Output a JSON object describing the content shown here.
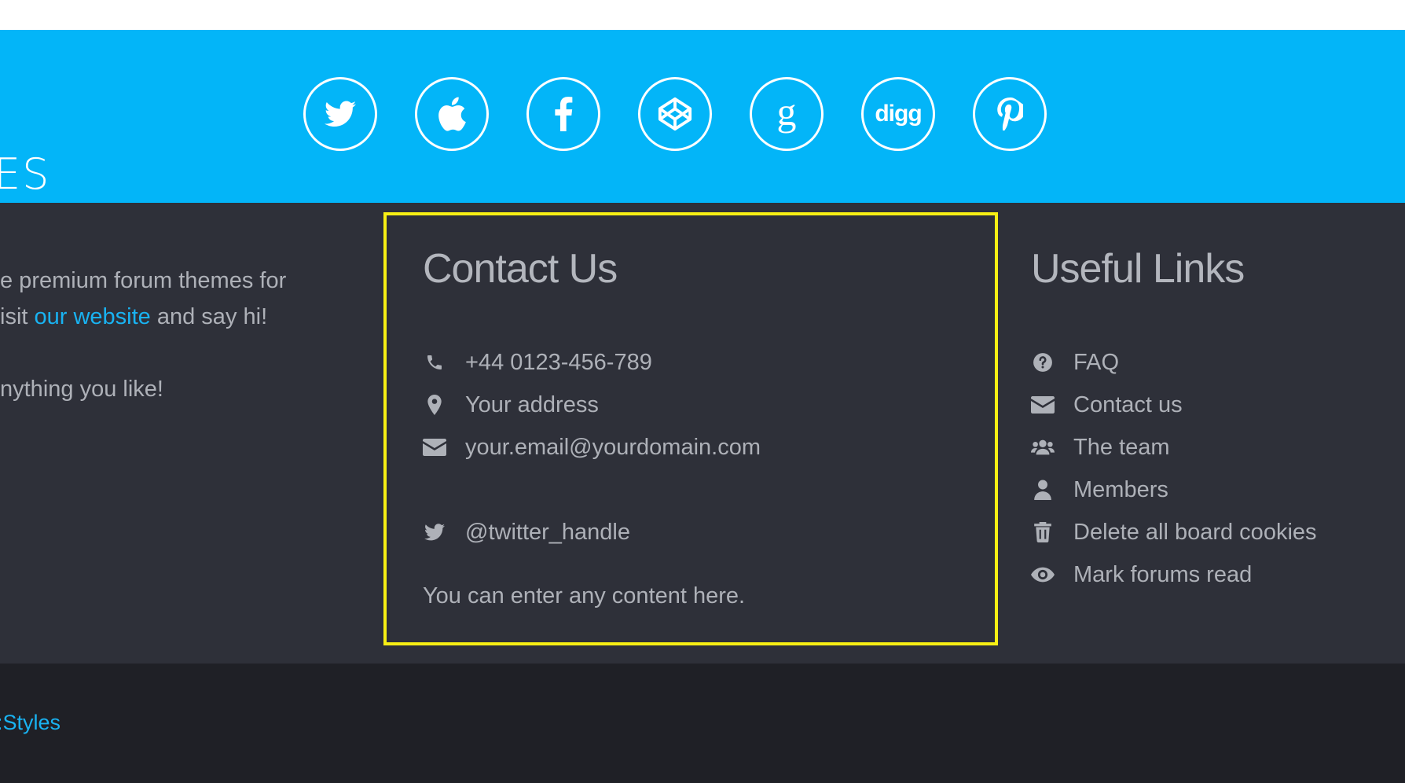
{
  "social": {
    "buttons": [
      {
        "name": "twitter",
        "icon": "twitter-icon"
      },
      {
        "name": "apple",
        "icon": "apple-icon"
      },
      {
        "name": "facebook",
        "icon": "facebook-icon"
      },
      {
        "name": "codepen",
        "icon": "codepen-icon"
      },
      {
        "name": "google-plus",
        "icon": "google-plus-icon",
        "glyph": "g"
      },
      {
        "name": "digg",
        "icon": "digg-icon",
        "glyph": "digg"
      },
      {
        "name": "pinterest",
        "icon": "pinterest-icon"
      }
    ]
  },
  "about": {
    "logo_fragment": "ES",
    "line1": "e premium forum themes for",
    "line2_prefix": "isit ",
    "line2_link": "our website",
    "line2_suffix": " and say hi!",
    "line3": "nything you like!"
  },
  "contact": {
    "title": "Contact Us",
    "phone": "+44 0123-456-789",
    "address": "Your address",
    "email": "your.email@yourdomain.com",
    "twitter": "@twitter_handle",
    "note": "You can enter any content here."
  },
  "links": {
    "title": "Useful Links",
    "items": [
      {
        "label": "FAQ",
        "icon": "question-circle-icon"
      },
      {
        "label": "Contact us",
        "icon": "envelope-icon"
      },
      {
        "label": "The team",
        "icon": "users-icon"
      },
      {
        "label": "Members",
        "icon": "user-icon"
      },
      {
        "label": "Delete all board cookies",
        "icon": "trash-icon"
      },
      {
        "label": "Mark forums read",
        "icon": "eye-icon"
      }
    ]
  },
  "copyright": {
    "text": ":Styles"
  },
  "colors": {
    "social_band": "#03b5f8",
    "footer_bg": "#2e3039",
    "bottom_bar": "#1f2026",
    "link": "#19b3f2",
    "highlight": "#f7ef14"
  }
}
